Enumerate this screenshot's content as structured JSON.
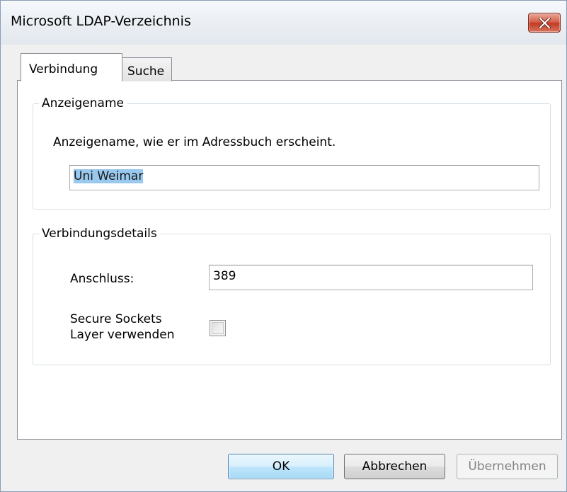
{
  "window": {
    "title": "Microsoft LDAP-Verzeichnis"
  },
  "tabs": [
    {
      "label": "Verbindung",
      "active": true
    },
    {
      "label": "Suche",
      "active": false
    }
  ],
  "display_name_group": {
    "title": "Anzeigename",
    "description": "Anzeigename, wie er im Adressbuch erscheint.",
    "value": "Uni Weimar"
  },
  "connection_group": {
    "title": "Verbindungsdetails",
    "port_label": "Anschluss:",
    "port_value": "389",
    "ssl_label_line1": "Secure Sockets",
    "ssl_label_line2": "Layer verwenden",
    "ssl_checked": false
  },
  "buttons": {
    "ok": "OK",
    "cancel": "Abbrechen",
    "apply": "Übernehmen"
  },
  "icons": {
    "close": "close-icon"
  },
  "colors": {
    "close_button": "#c9432b",
    "selection": "#99c9ef",
    "default_button_border": "#3c7fb1"
  }
}
